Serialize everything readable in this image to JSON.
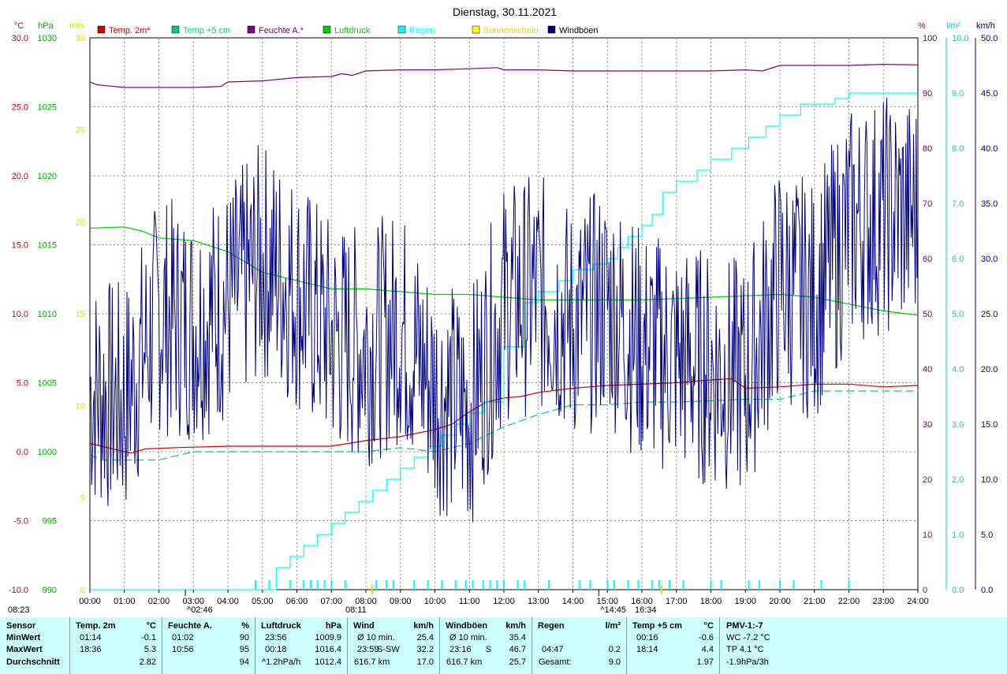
{
  "chart_data": {
    "type": "line",
    "title": "Dienstag, 30.11.2021",
    "x_ticks": [
      "00:00",
      "01:00",
      "02:00",
      "03:00",
      "04:00",
      "05:00",
      "06:00",
      "07:00",
      "08:00",
      "09:00",
      "10:00",
      "11:00",
      "12:00",
      "13:00",
      "14:00",
      "15:00",
      "16:00",
      "17:00",
      "18:00",
      "19:00",
      "20:00",
      "21:00",
      "22:00",
      "23:00",
      "24:00"
    ],
    "axes": {
      "temp": {
        "unit": "°C",
        "min": -10,
        "max": 30,
        "ticks": [
          "30.0",
          "25.0",
          "20.0",
          "15.0",
          "10.0",
          "5.0",
          "0.0",
          "-5.0",
          "-10.0"
        ],
        "color": "#cc0000"
      },
      "pressure": {
        "unit": "hPa",
        "min": 990,
        "max": 1030,
        "ticks": [
          "1030",
          "1025",
          "1020",
          "1015",
          "1010",
          "1005",
          "1000",
          "995",
          "990"
        ],
        "color": "#00aa00"
      },
      "sunshine": {
        "unit": "min",
        "min": 0,
        "max": 30,
        "ticks": [
          "30",
          "25",
          "20",
          "15",
          "10",
          "5",
          "0"
        ],
        "color": "#cccc00"
      },
      "humidity": {
        "unit": "%",
        "min": 0,
        "max": 100,
        "ticks": [
          "100",
          "90",
          "80",
          "70",
          "60",
          "50",
          "40",
          "30",
          "20",
          "10",
          "0"
        ],
        "color": "#800080"
      },
      "rain": {
        "unit": "l/m²",
        "min": 0,
        "max": 10,
        "ticks": [
          "10.0",
          "9.0",
          "8.0",
          "7.0",
          "6.0",
          "5.0",
          "4.0",
          "3.0",
          "2.0",
          "1.0",
          "0.0"
        ],
        "color": "#00cccc"
      },
      "wind": {
        "unit": "km/h",
        "min": 0,
        "max": 50,
        "ticks": [
          "50.0",
          "45.0",
          "40.0",
          "35.0",
          "30.0",
          "25.0",
          "20.0",
          "15.0",
          "10.0",
          "5.0",
          "0.0"
        ],
        "color": "#000080"
      }
    },
    "legend": [
      {
        "name": "Temp. 2m*",
        "color": "#cc0000"
      },
      {
        "name": "Temp +5 cm",
        "color": "#00cc88"
      },
      {
        "name": "Feuchte A.*",
        "color": "#800080"
      },
      {
        "name": "Luftdruck",
        "color": "#00cc00"
      },
      {
        "name": "Regen",
        "color": "#00ffff"
      },
      {
        "name": "Sonnenschein",
        "color": "#ffff00"
      },
      {
        "name": "Windböen",
        "color": "#000080"
      }
    ],
    "series": [
      {
        "name": "Temp. 2m*",
        "axis": "temp",
        "color": "#cc0000",
        "style": "solid",
        "x": [
          0,
          0.5,
          1.2,
          1.6,
          2.5,
          4,
          5,
          6,
          7,
          7.5,
          8,
          9,
          10,
          10.5,
          11,
          11.5,
          12,
          12.5,
          13,
          14,
          15,
          16,
          17,
          18,
          18.6,
          19,
          20,
          21,
          22,
          23,
          24
        ],
        "y": [
          0.6,
          0.3,
          -0.1,
          0.2,
          0.3,
          0.4,
          0.4,
          0.4,
          0.4,
          0.6,
          0.8,
          1.1,
          1.6,
          2.0,
          2.9,
          3.6,
          3.9,
          4.0,
          4.3,
          4.6,
          4.8,
          4.9,
          5.0,
          5.2,
          5.3,
          4.6,
          4.7,
          4.9,
          4.9,
          4.7,
          4.8
        ]
      },
      {
        "name": "Temp +5 cm",
        "axis": "temp",
        "color": "#00cc88",
        "style": "dashed",
        "x": [
          0,
          0.3,
          1,
          2,
          3,
          3.5,
          4,
          6,
          8,
          9,
          10,
          10.5,
          11,
          11.5,
          12,
          13,
          14,
          15,
          16,
          17,
          18,
          19,
          20,
          21,
          22,
          23,
          24
        ],
        "y": [
          -0.2,
          -0.6,
          -0.6,
          -0.6,
          0,
          0,
          0,
          0,
          0,
          0.3,
          0,
          0.3,
          0.6,
          1.2,
          1.8,
          2.7,
          3.4,
          3.4,
          3.6,
          3.6,
          3.7,
          3.8,
          3.8,
          4.4,
          4.4,
          4.4,
          4.4
        ]
      },
      {
        "name": "Feuchte A.*",
        "axis": "humidity",
        "color": "#800080",
        "style": "solid",
        "x": [
          0,
          0.2,
          1,
          1.5,
          2,
          3,
          3.8,
          4,
          5,
          6,
          7,
          7.3,
          7.6,
          8,
          9,
          10,
          11,
          11.8,
          12,
          13,
          14,
          15,
          16,
          17,
          18,
          19,
          19.5,
          20,
          21,
          22,
          23,
          24
        ],
        "y": [
          92,
          91.5,
          91,
          91,
          91,
          91,
          91.2,
          92,
          92.2,
          92.8,
          93,
          93.5,
          93.2,
          94,
          94.2,
          94.2,
          94.4,
          94.6,
          94.2,
          94.2,
          94,
          94,
          94,
          94,
          94,
          94.2,
          94,
          95,
          95,
          95,
          95.2,
          95.1
        ]
      },
      {
        "name": "Luftdruck",
        "axis": "pressure",
        "color": "#00cc00",
        "style": "solid",
        "x": [
          0,
          1,
          1.5,
          2,
          3,
          4,
          5,
          6,
          7,
          8,
          9,
          10,
          11,
          12,
          13,
          14,
          15,
          16,
          17,
          18,
          19,
          20,
          21,
          22,
          23,
          24
        ],
        "y": [
          1016.2,
          1016.3,
          1016.0,
          1015.5,
          1015.3,
          1014.5,
          1013.0,
          1012.4,
          1011.8,
          1011.8,
          1011.6,
          1011.4,
          1011.4,
          1011.2,
          1011.0,
          1011.0,
          1011.0,
          1011.0,
          1011.1,
          1011.2,
          1011.3,
          1011.4,
          1011.2,
          1010.7,
          1010.2,
          1009.9
        ]
      },
      {
        "name": "Regen",
        "axis": "rain",
        "color": "#00ffff",
        "style": "steps",
        "x": [
          0,
          4.8,
          5.4,
          5.8,
          6.2,
          6.6,
          7,
          7.4,
          7.8,
          8.2,
          8.6,
          9,
          9.4,
          9.8,
          10.2,
          10.6,
          11,
          11.4,
          12,
          12.6,
          13,
          13.6,
          14,
          14.6,
          15,
          15.3,
          15.6,
          16,
          16.3,
          16.6,
          17,
          17.6,
          18,
          18.6,
          19.1,
          19.6,
          20,
          20.6,
          21.2,
          21.6,
          22,
          22.5,
          23,
          24
        ],
        "y": [
          0,
          0,
          0.4,
          0.6,
          0.8,
          1.0,
          1.2,
          1.4,
          1.6,
          1.8,
          2.0,
          2.2,
          2.4,
          2.6,
          2.8,
          3.0,
          3.2,
          3.4,
          4.4,
          5.2,
          5.4,
          5.6,
          5.8,
          5.9,
          6.0,
          6.2,
          6.4,
          6.6,
          6.8,
          7.2,
          7.4,
          7.6,
          7.8,
          8.0,
          8.2,
          8.4,
          8.6,
          8.8,
          8.8,
          8.9,
          9.0,
          9.0,
          9.0,
          9.0
        ]
      },
      {
        "name": "Windböen",
        "axis": "wind",
        "color": "#000080",
        "style": "jagged",
        "x": [
          0,
          1,
          2,
          3,
          4,
          5,
          6,
          7,
          8,
          9,
          10,
          11,
          12,
          13,
          14,
          15,
          16,
          17,
          18,
          19,
          20,
          21,
          22,
          23,
          24
        ],
        "y": [
          18,
          17,
          25,
          24,
          26,
          30,
          27,
          23,
          22,
          24,
          18,
          16,
          26,
          27,
          24,
          26,
          22,
          21,
          20,
          19,
          28,
          26,
          33,
          34,
          34
        ]
      }
    ],
    "sunshine_marks": {
      "times": [
        "08:11",
        "16:34"
      ],
      "labels": [
        "08:23",
        "08:11",
        "16:34"
      ]
    },
    "rain_ticks_x": [
      4.8,
      5.2,
      5.8,
      6.2,
      6.4,
      6.6,
      6.8,
      7,
      7.4,
      8.3,
      8.6,
      8.8,
      9.4,
      9.8,
      10.2,
      10.6,
      10.9,
      11.1,
      11.4,
      11.6,
      11.8,
      12.0,
      12.4,
      12.6,
      13.3,
      14.2,
      14.5,
      15.0,
      15.2,
      15.6,
      15.9,
      16.3,
      16.5,
      16.8,
      17.2,
      18.0,
      18.3,
      19.1,
      19.4,
      20.0,
      20.4,
      21.2,
      22.0
    ],
    "markers": [
      {
        "time": "02:46",
        "label": "^02:46"
      },
      {
        "time": "14:45",
        "label": "^14:45"
      }
    ],
    "ylabel_left1": "°C",
    "ylabel_left2": "hPa",
    "ylabel_left3": "min",
    "ylabel_right1": "%",
    "ylabel_right2": "l/m²",
    "ylabel_right3": "km/h",
    "grid": true
  },
  "stats": {
    "rowlabels": {
      "sensor": "Sensor",
      "min": "MinWert",
      "max": "MaxWert",
      "avg": "Durchschnitt"
    },
    "temp2m": {
      "h1": "Temp. 2m",
      "h2": "°C",
      "min_t": "01:14",
      "min_v": "-0.1",
      "max_t": "18:36",
      "max_v": "5.3",
      "avg_v": "2.82"
    },
    "humidity": {
      "h1": "Feuchte A.",
      "h2": "%",
      "min_t": "01:02",
      "min_v": "90",
      "max_t": "10:56",
      "max_v": "95",
      "avg_v": "94"
    },
    "pressure": {
      "h1": "Luftdruck",
      "h2": "hPa",
      "min_t": "23:56",
      "min_v": "1009.9",
      "max_t": "00:18",
      "max_v": "1016.4",
      "avg_t": "^1.2hPa/h",
      "avg_v": "1012.4"
    },
    "wind": {
      "h1": "Wind",
      "h2": "km/h",
      "min_t": "Ø 10 min.",
      "min_v": "25.4",
      "max_t": "23:59",
      "max_d": "S-SW",
      "max_v": "32.2",
      "avg_t": "616.7 km",
      "avg_v": "17.0"
    },
    "gusts": {
      "h1": "Windböen",
      "h2": "km/h",
      "min_t": "Ø 10 min.",
      "min_v": "35.4",
      "max_t": "23:16",
      "max_d": "S",
      "max_v": "46.7",
      "avg_t": "616.7 km",
      "avg_v": "25.7"
    },
    "rain": {
      "h1": "Regen",
      "h2": "l/m²",
      "max_t": "04:47",
      "max_v": "0.2",
      "avg_t": "Gesamt:",
      "avg_v": "9.0"
    },
    "temp5cm": {
      "h1": "Temp +5 cm",
      "h2": "°C",
      "min_t": "00:16",
      "min_v": "-0.6",
      "max_t": "18:14",
      "max_v": "4.4",
      "avg_v": "1.97"
    },
    "pmv": {
      "h1": "PMV-1:-7",
      "min": "WC -7.2 °C",
      "max": "TP 4.1 °C",
      "avg": "-1.9hPa/3h"
    }
  }
}
